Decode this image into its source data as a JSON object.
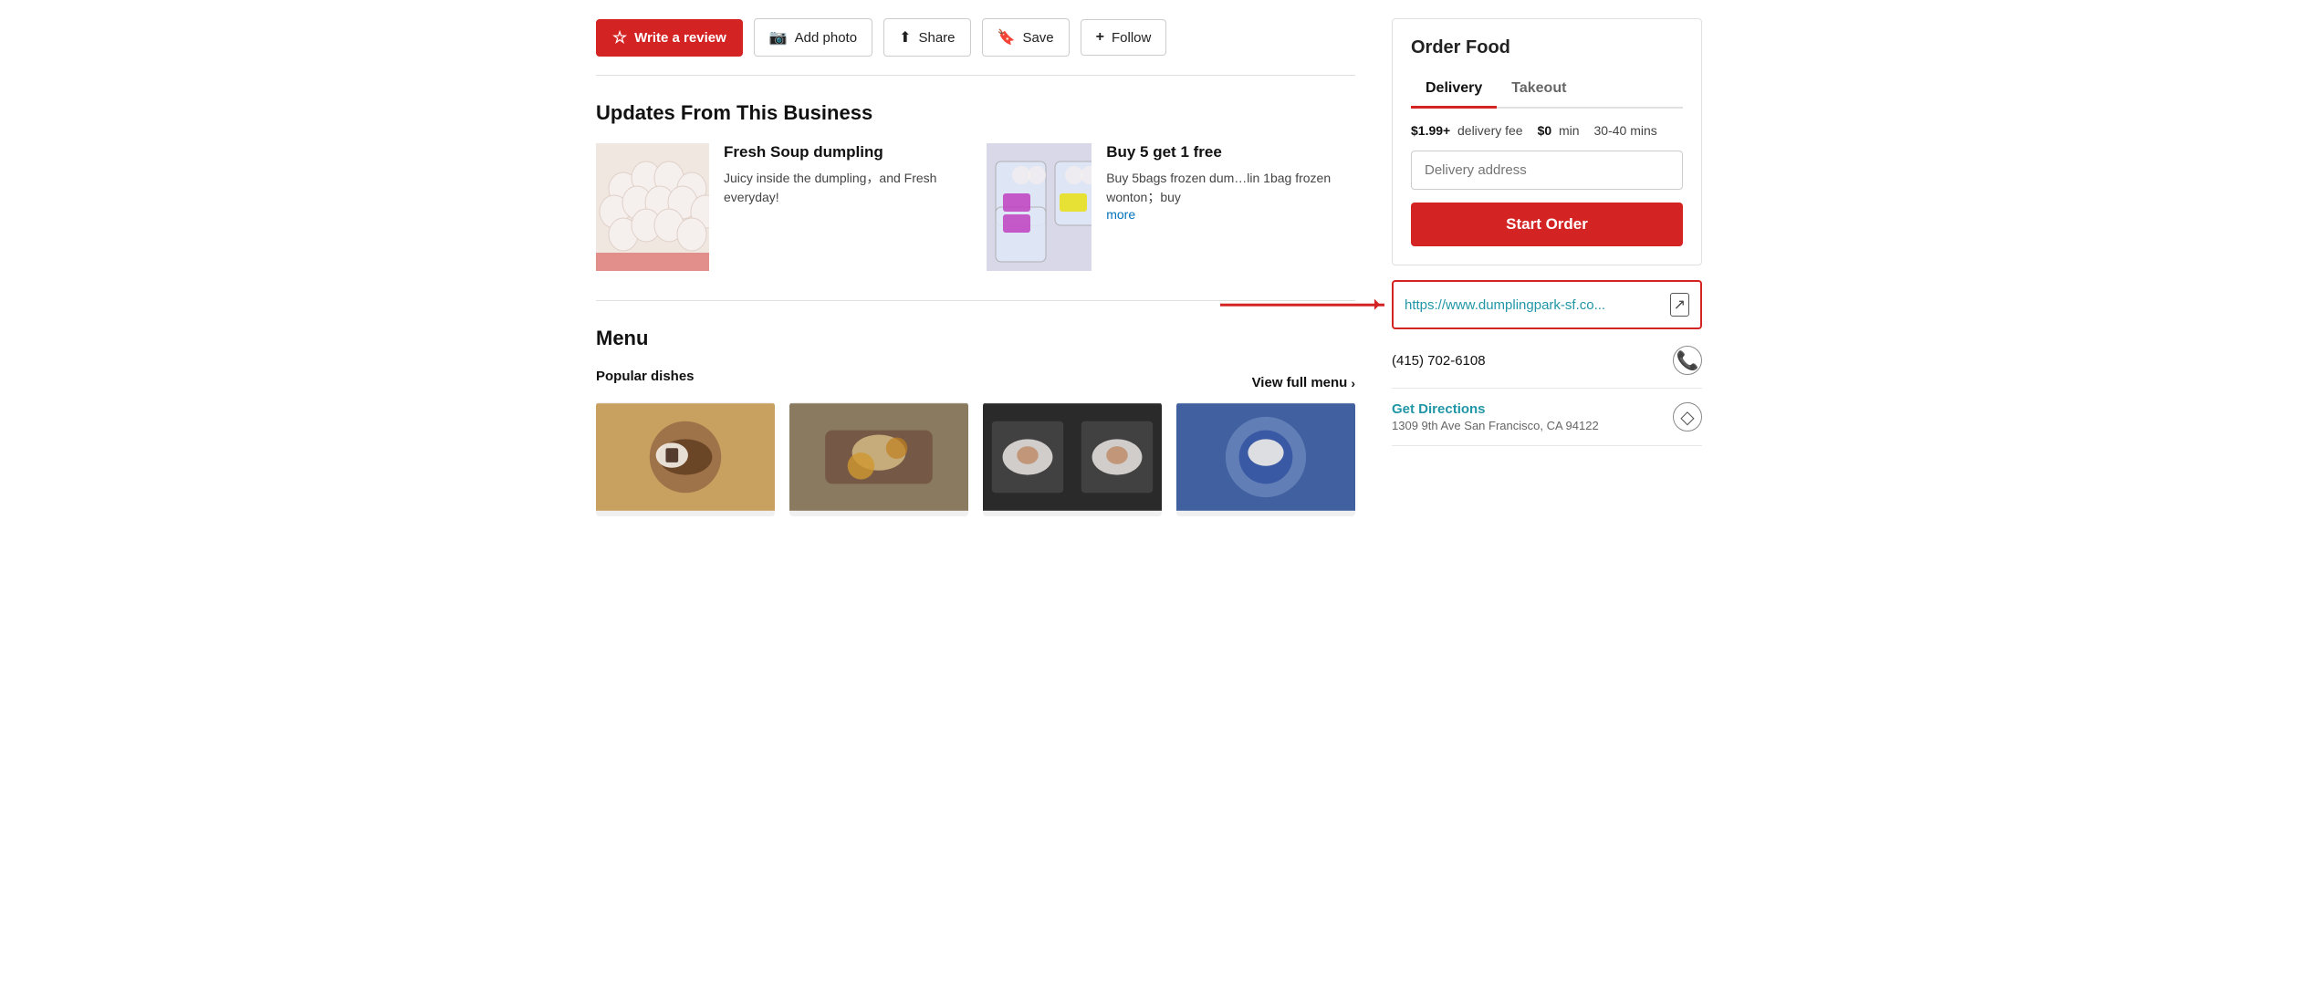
{
  "actionBar": {
    "writeReview": "Write a review",
    "addPhoto": "Add photo",
    "share": "Share",
    "save": "Save",
    "follow": "Follow"
  },
  "updates": {
    "sectionTitle": "Updates From This Business",
    "cards": [
      {
        "title": "Fresh Soup dumpling",
        "description": "Juicy inside the dumpling，and Fresh everyday!"
      },
      {
        "title": "Buy 5 get 1 free",
        "description": "Buy 5bags frozen dum…lin 1bag frozen wonton；buy",
        "moreLabel": "more"
      }
    ]
  },
  "menu": {
    "sectionTitle": "Menu",
    "popularDishes": "Popular dishes",
    "viewFullMenu": "View full menu"
  },
  "orderFood": {
    "title": "Order Food",
    "tabs": [
      "Delivery",
      "Takeout"
    ],
    "activeTab": 0,
    "deliveryFee": "$1.99+",
    "deliveryFeeLabel": "delivery fee",
    "minOrder": "$0",
    "minOrderLabel": "min",
    "timeEstimate": "30-40 mins",
    "addressPlaceholder": "Delivery address",
    "startOrderLabel": "Start Order"
  },
  "sidebarInfo": {
    "website": "https://www.dumplingpark-sf.co...",
    "phone": "(415) 702-6108",
    "getDirections": "Get Directions",
    "address": "1309 9th Ave San Francisco, CA 94122"
  }
}
